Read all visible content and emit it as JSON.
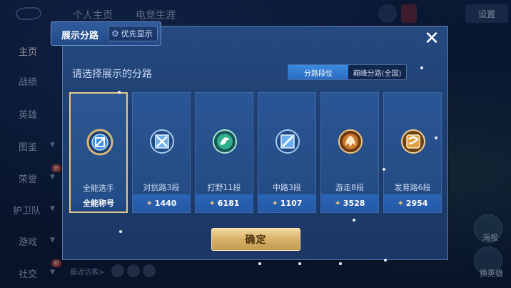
{
  "background": {
    "top_tabs": [
      "个人主页",
      "电竞生涯"
    ],
    "top_right": {
      "btn1": "设置"
    },
    "sidebar": [
      {
        "label": "主页",
        "active": true,
        "arrow": false,
        "badge": ""
      },
      {
        "label": "战绩",
        "active": false,
        "arrow": false,
        "badge": ""
      },
      {
        "label": "英雄",
        "active": false,
        "arrow": false,
        "badge": ""
      },
      {
        "label": "图鉴",
        "active": false,
        "arrow": true,
        "badge": ""
      },
      {
        "label": "荣誉",
        "active": false,
        "arrow": true,
        "badge": "新"
      },
      {
        "label": "护卫队",
        "active": false,
        "arrow": true,
        "badge": ""
      },
      {
        "label": "游戏",
        "active": false,
        "arrow": true,
        "badge": ""
      },
      {
        "label": "社交",
        "active": false,
        "arrow": true,
        "badge": "新"
      }
    ],
    "recent_visitors_label": "最近访客>",
    "right_labels": {
      "share": "海报",
      "change_hero": "换英雄"
    }
  },
  "modal": {
    "title": "展示分路",
    "priority_label": "优先显示",
    "close_symbol": "✕",
    "prompt": "请选择展示的分路",
    "segments": [
      {
        "label": "分路段位",
        "active": true
      },
      {
        "label": "巅峰分路(全国)",
        "active": false
      }
    ],
    "cards": [
      {
        "name": "全能选手",
        "value": "全能称号",
        "selected": true,
        "show_star": false,
        "emblem": "allround-emblem-icon",
        "color": "#6fb6ff"
      },
      {
        "name": "对抗路3段",
        "value": "1440",
        "selected": false,
        "show_star": true,
        "emblem": "clash-lane-emblem-icon",
        "color": "#8fc7ff"
      },
      {
        "name": "打野11段",
        "value": "6181",
        "selected": false,
        "show_star": true,
        "emblem": "jungle-emblem-icon",
        "color": "#4fd6a7"
      },
      {
        "name": "中路3段",
        "value": "1107",
        "selected": false,
        "show_star": true,
        "emblem": "mid-lane-emblem-icon",
        "color": "#8fc7ff"
      },
      {
        "name": "游走8段",
        "value": "3528",
        "selected": false,
        "show_star": true,
        "emblem": "roam-emblem-icon",
        "color": "#d98b3c"
      },
      {
        "name": "发育路6段",
        "value": "2954",
        "selected": false,
        "show_star": true,
        "emblem": "farm-lane-emblem-icon",
        "color": "#e0a040"
      }
    ],
    "confirm_label": "确定"
  },
  "colors": {
    "gold": "#e6c98a",
    "accent_blue": "#2a6cc4",
    "star": "#e7c17b"
  }
}
